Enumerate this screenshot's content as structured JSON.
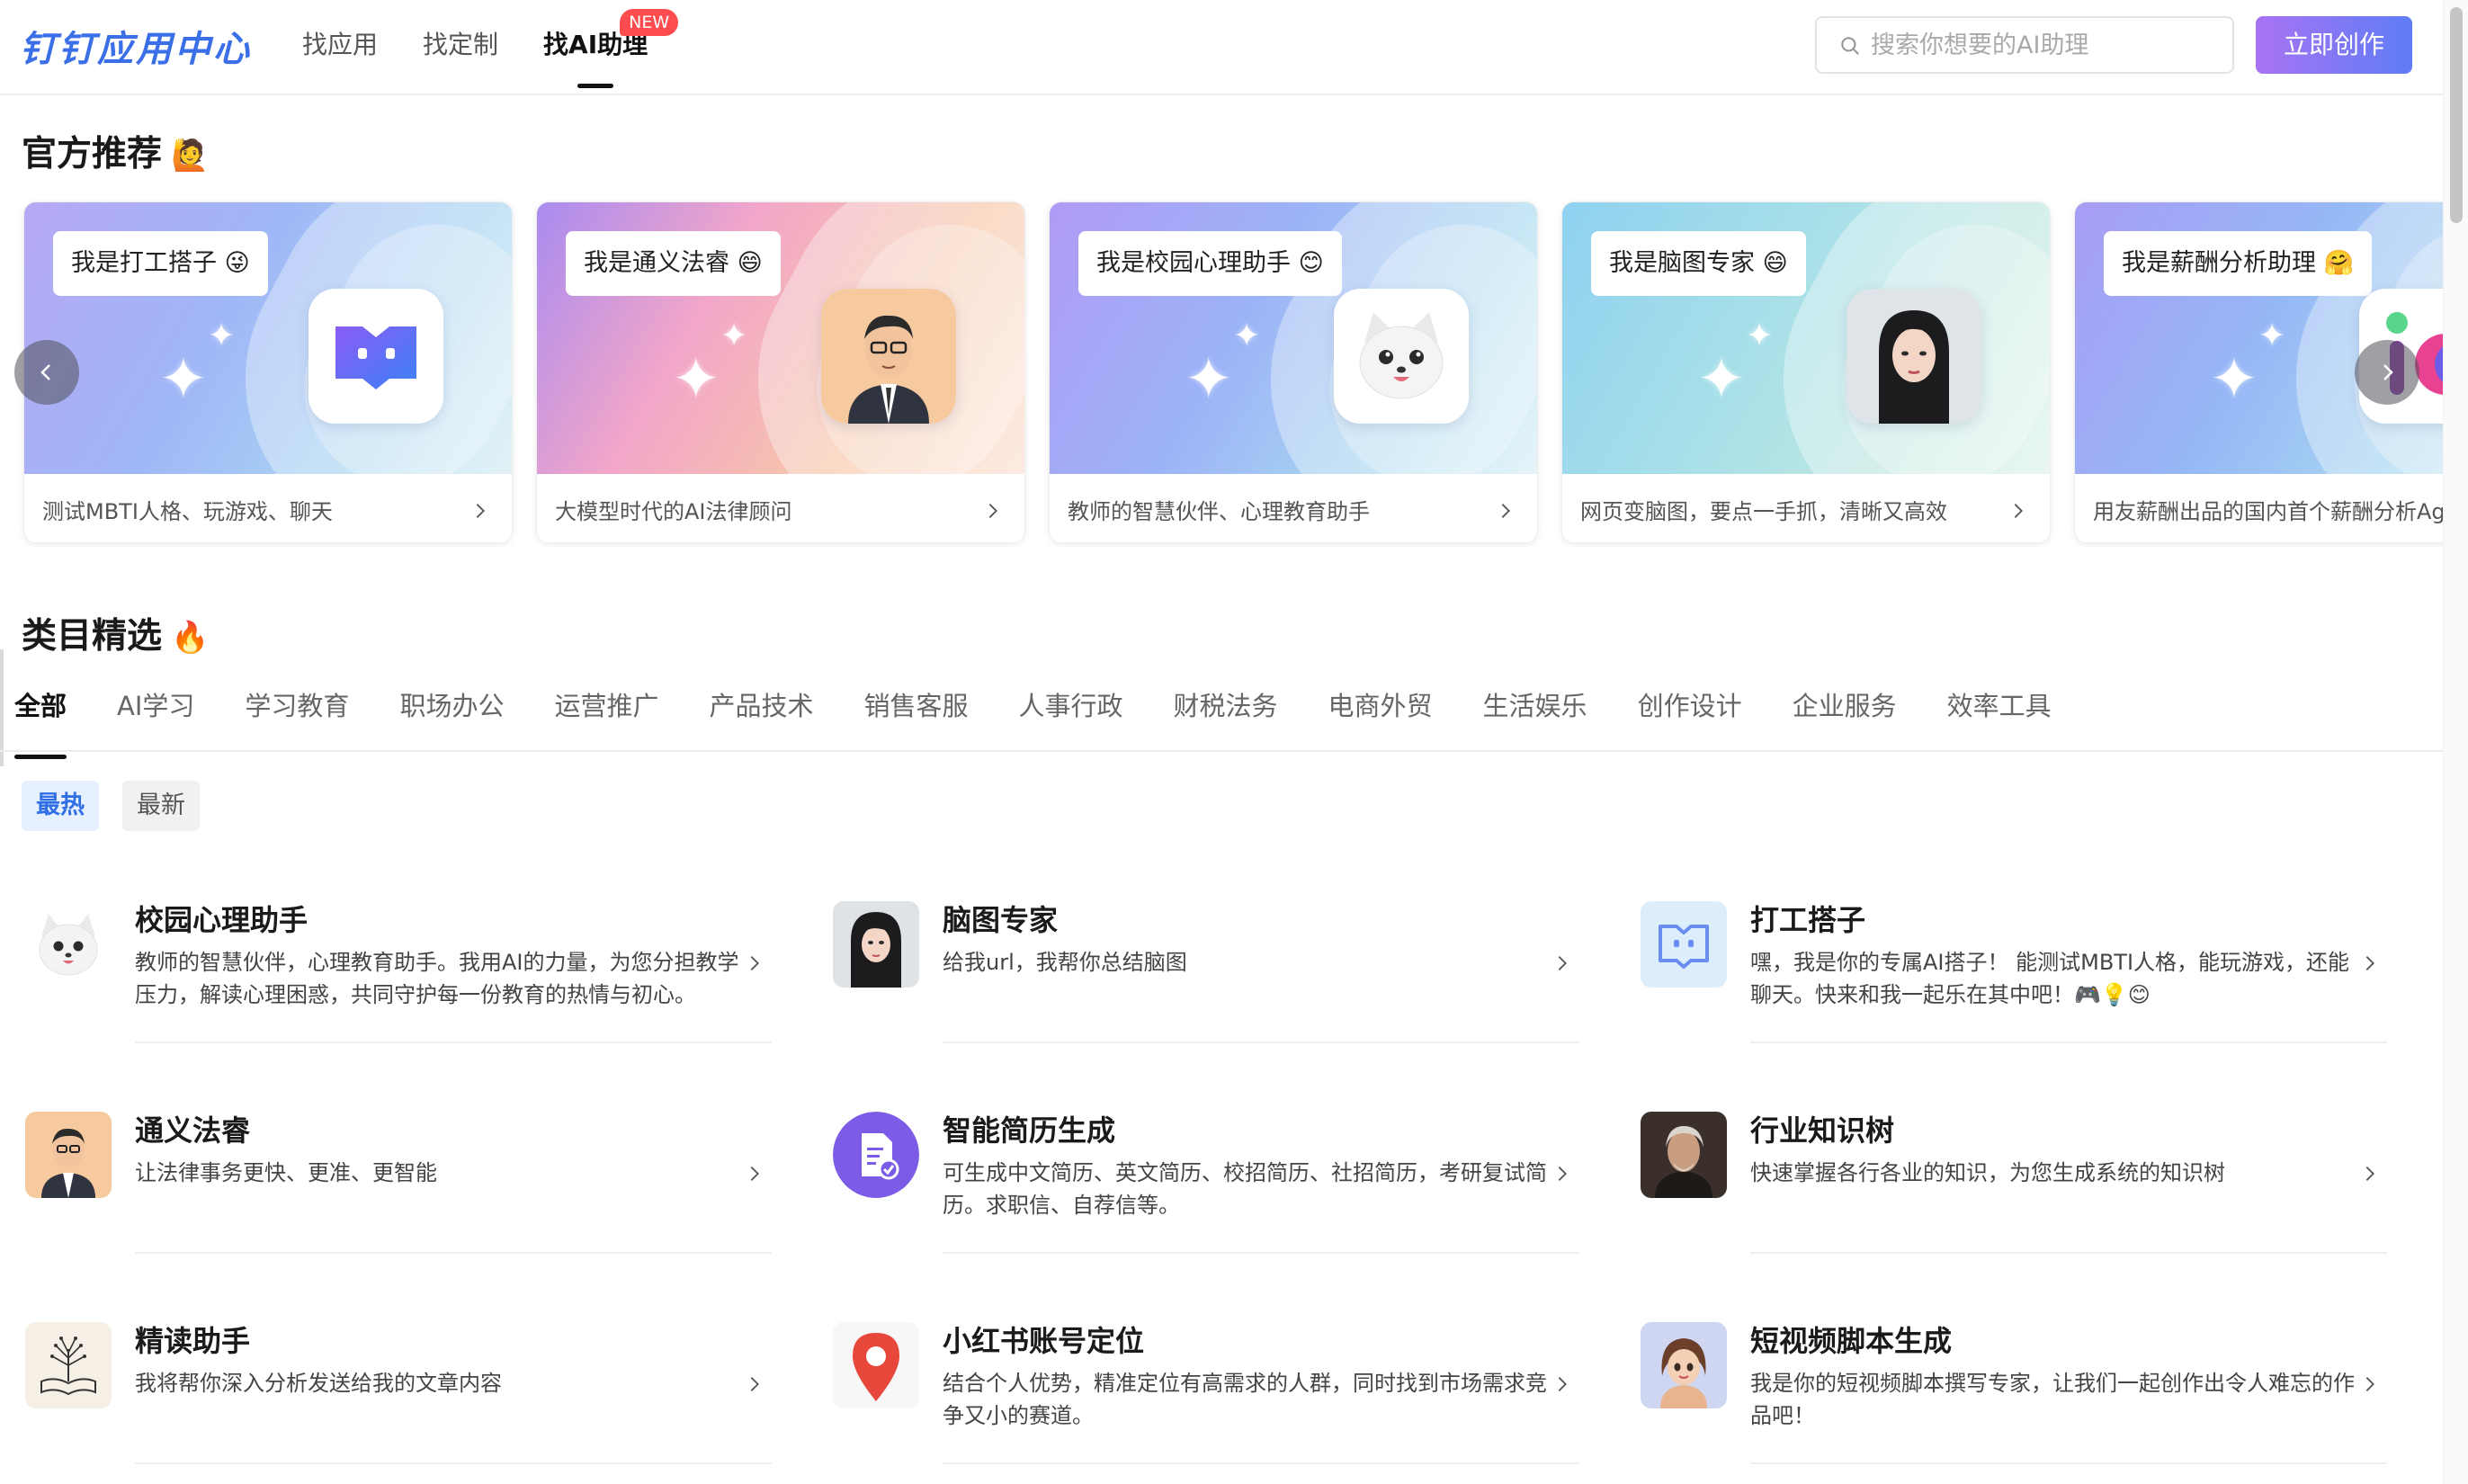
{
  "header": {
    "logo": "钉钉应用中心",
    "nav": [
      {
        "label": "找应用"
      },
      {
        "label": "找定制"
      },
      {
        "label": "找AI助理",
        "badge": "NEW"
      }
    ],
    "search_placeholder": "搜索你想要的AI助理",
    "create_button": "立即创作"
  },
  "official": {
    "title": "官方推荐",
    "cards": [
      {
        "bubble": "我是打工搭子 😜",
        "desc": "测试MBTI人格、玩游戏、聊天"
      },
      {
        "bubble": "我是通义法睿 😄",
        "desc": "大模型时代的AI法律顾问"
      },
      {
        "bubble": "我是校园心理助手 😊",
        "desc": "教师的智慧伙伴、心理教育助手"
      },
      {
        "bubble": "我是脑图专家 😄",
        "desc": "网页变脑图，要点一手抓，清晰又高效"
      },
      {
        "bubble": "我是薪酬分析助理 🤗",
        "desc": "用友薪酬出品的国内首个薪酬分析Agent"
      }
    ]
  },
  "category": {
    "title": "类目精选",
    "tabs": [
      "全部",
      "AI学习",
      "学习教育",
      "职场办公",
      "运营推广",
      "产品技术",
      "销售客服",
      "人事行政",
      "财税法务",
      "电商外贸",
      "生活娱乐",
      "创作设计",
      "企业服务",
      "效率工具"
    ],
    "sort": {
      "hot": "最热",
      "new": "最新"
    }
  },
  "apps": [
    {
      "name": "校园心理助手",
      "desc": "教师的智慧伙伴，心理教育助手。我用AI的力量，为您分担教学压力，解读心理困惑，共同守护每一份教育的热情与初心。"
    },
    {
      "name": "脑图专家",
      "desc": "给我url，我帮你总结脑图"
    },
    {
      "name": "打工搭子",
      "desc": "嘿，我是你的专属AI搭子！ 能测试MBTI人格，能玩游戏，还能聊天。快来和我一起乐在其中吧！🎮💡😊"
    },
    {
      "name": "通义法睿",
      "desc": "让法律事务更快、更准、更智能"
    },
    {
      "name": "智能简历生成",
      "desc": "可生成中文简历、英文简历、校招简历、社招简历，考研复试简历。求职信、自荐信等。"
    },
    {
      "name": "行业知识树",
      "desc": "快速掌握各行各业的知识，为您生成系统的知识树"
    },
    {
      "name": "精读助手",
      "desc": "我将帮你深入分析发送给我的文章内容"
    },
    {
      "name": "小红书账号定位",
      "desc": "结合个人优势，精准定位有高需求的人群，同时找到市场需求竞争又小的赛道。"
    },
    {
      "name": "短视频脚本生成",
      "desc": "我是你的短视频脚本撰写专家，让我们一起创作出令人难忘的作品吧！"
    }
  ],
  "colors": {
    "accent": "#3b6fe8",
    "badge": "#ff4d4f",
    "button_from": "#a873f3",
    "button_to": "#5f7df6"
  }
}
